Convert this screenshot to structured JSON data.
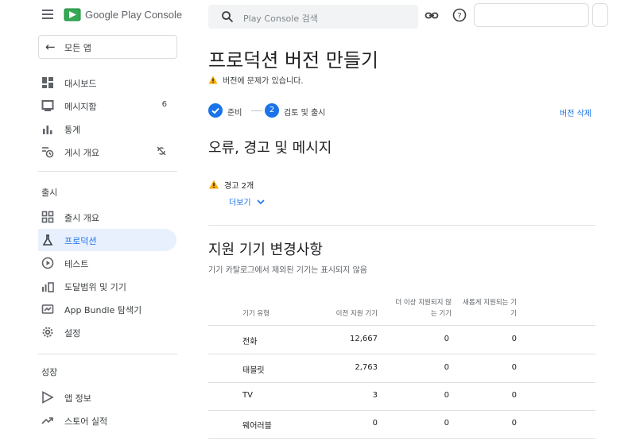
{
  "brand": "Google Play Console",
  "colors": {
    "accent": "#1a73e8",
    "active_bg": "#e8f0fe",
    "warning": "#f9ab00"
  },
  "sidebar": {
    "back_label": "모든 앱",
    "items_top": [
      {
        "label": "대시보드",
        "icon": "dashboard-icon"
      },
      {
        "label": "메시지함",
        "icon": "inbox-icon",
        "count": "6"
      },
      {
        "label": "통계",
        "icon": "stats-icon"
      },
      {
        "label": "게시 개요",
        "icon": "publishing-overview-icon",
        "trail_icon": "sync-off-icon"
      }
    ],
    "section_release": "출시",
    "items_release": [
      {
        "label": "출시 개요",
        "icon": "release-overview-icon"
      },
      {
        "label": "프로덕션",
        "icon": "production-icon",
        "active": true
      },
      {
        "label": "테스트",
        "icon": "testing-icon"
      },
      {
        "label": "도달범위 및 기기",
        "icon": "reach-devices-icon"
      },
      {
        "label": "App Bundle 탐색기",
        "icon": "app-bundle-icon"
      },
      {
        "label": "설정",
        "icon": "settings-gear-icon"
      }
    ],
    "section_growth": "성장",
    "items_growth": [
      {
        "label": "앱 정보",
        "icon": "store-presence-icon"
      },
      {
        "label": "스토어 실적",
        "icon": "trending-icon"
      }
    ]
  },
  "search": {
    "placeholder": "Play Console 검색"
  },
  "main": {
    "title": "프로덕션 버전 만들기",
    "warning": "버전에 문제가 있습니다.",
    "steps": [
      {
        "label": "준비",
        "state": "done"
      },
      {
        "label": "검토 및 출시",
        "state": "current",
        "number": "2"
      }
    ],
    "delete_link": "버전 삭제",
    "errors_heading": "오류, 경고 및 메시지",
    "warning_count": "경고 2개",
    "more_link": "더보기",
    "devices_heading": "지원 기기 변경사항",
    "devices_subtitle": "기기 카탈로그에서 제외된 기기는 표시되지 않음",
    "table": {
      "headers": [
        "기기 유형",
        "이전 지원 기기",
        "더 이상 지원되지 않는 기기",
        "새롭게 지원되는 기기"
      ],
      "rows": [
        [
          "전화",
          "12,667",
          "0",
          "0"
        ],
        [
          "태블릿",
          "2,763",
          "0",
          "0"
        ],
        [
          "TV",
          "3",
          "0",
          "0"
        ],
        [
          "웨어러블",
          "0",
          "0",
          "0"
        ]
      ]
    }
  }
}
